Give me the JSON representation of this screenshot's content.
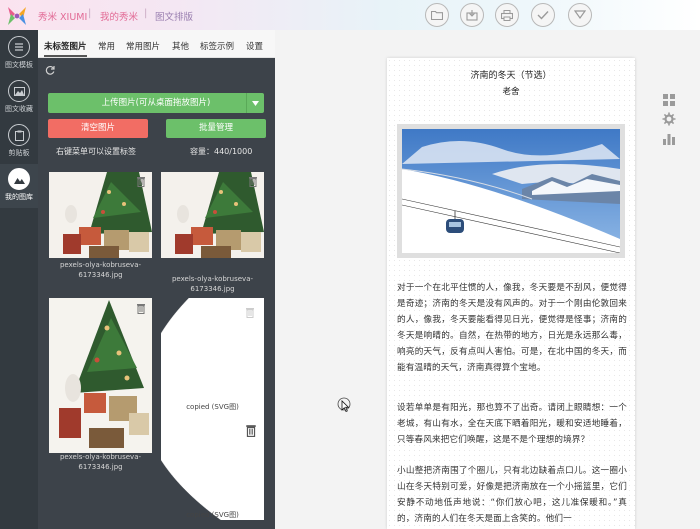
{
  "app": {
    "name": "秀米 XIUMI",
    "breadcrumb_1": "我的秀米",
    "breadcrumb_2": "图文排版"
  },
  "toolbar": {
    "icons": [
      "folder-icon",
      "export-icon",
      "print-icon",
      "check-icon",
      "preview-icon"
    ]
  },
  "leftnav": {
    "items": [
      {
        "label": "图文模板"
      },
      {
        "label": "图文收藏"
      },
      {
        "label": "剪贴板"
      },
      {
        "label": "我的图库"
      }
    ]
  },
  "tabs": [
    "未标签图片",
    "常用",
    "常用图片",
    "其他",
    "标签示例",
    "设置"
  ],
  "panel": {
    "upload_label": "上传图片(可从桌面拖放图片)",
    "clear_label": "清空图片",
    "batch_label": "批量管理",
    "hint": "右键菜单可以设置标签",
    "capacity": "容量：440/1000"
  },
  "images": [
    {
      "name": "pexels-olya-kobruseva-6173346.jpg"
    },
    {
      "name": "pexels-olya-kobruseva-6173346.jpg"
    },
    {
      "name": "pexels-olya-kobruseva-6173346.jpg"
    },
    {
      "name": "copied (SVG图)"
    },
    {
      "name": "copied (SVG图)"
    }
  ],
  "document": {
    "title": "济南的冬天（节选）",
    "author": "老舍",
    "p1": "对于一个在北平住惯的人，像我，冬天要是不刮风，便觉得是奇迹；济南的冬天是没有风声的。对于一个刚由伦敦回来的人，像我，冬天要能看得见日光，便觉得是怪事；济南的冬天是响晴的。自然，在热带的地方，日光是永远那么毒，响亮的天气，反有点叫人害怕。可是，在北中国的冬天，而能有温晴的天气，济南真得算个宝地。",
    "p2": "设若单单是有阳光，那也算不了出奇。请闭上眼睛想：一个老城，有山有水，全在天底下晒着阳光，暖和安适地睡着，只等春风来把它们唤醒，这是不是个理想的境界？",
    "p3": "小山整把济南围了个圈儿，只有北边缺着点口儿。这一圈小山在冬天特别可爱，好像是把济南放在一个小摇篮里，它们安静不动地低声地说：“你们放心吧，这儿准保暖和。”真的，济南的人们在冬天是面上含笑的。他们一"
  },
  "colors": {
    "accent_green": "#6cc06a",
    "accent_red": "#f26d64",
    "nav_bg": "#333a40",
    "panel_bg": "#3d434a"
  }
}
